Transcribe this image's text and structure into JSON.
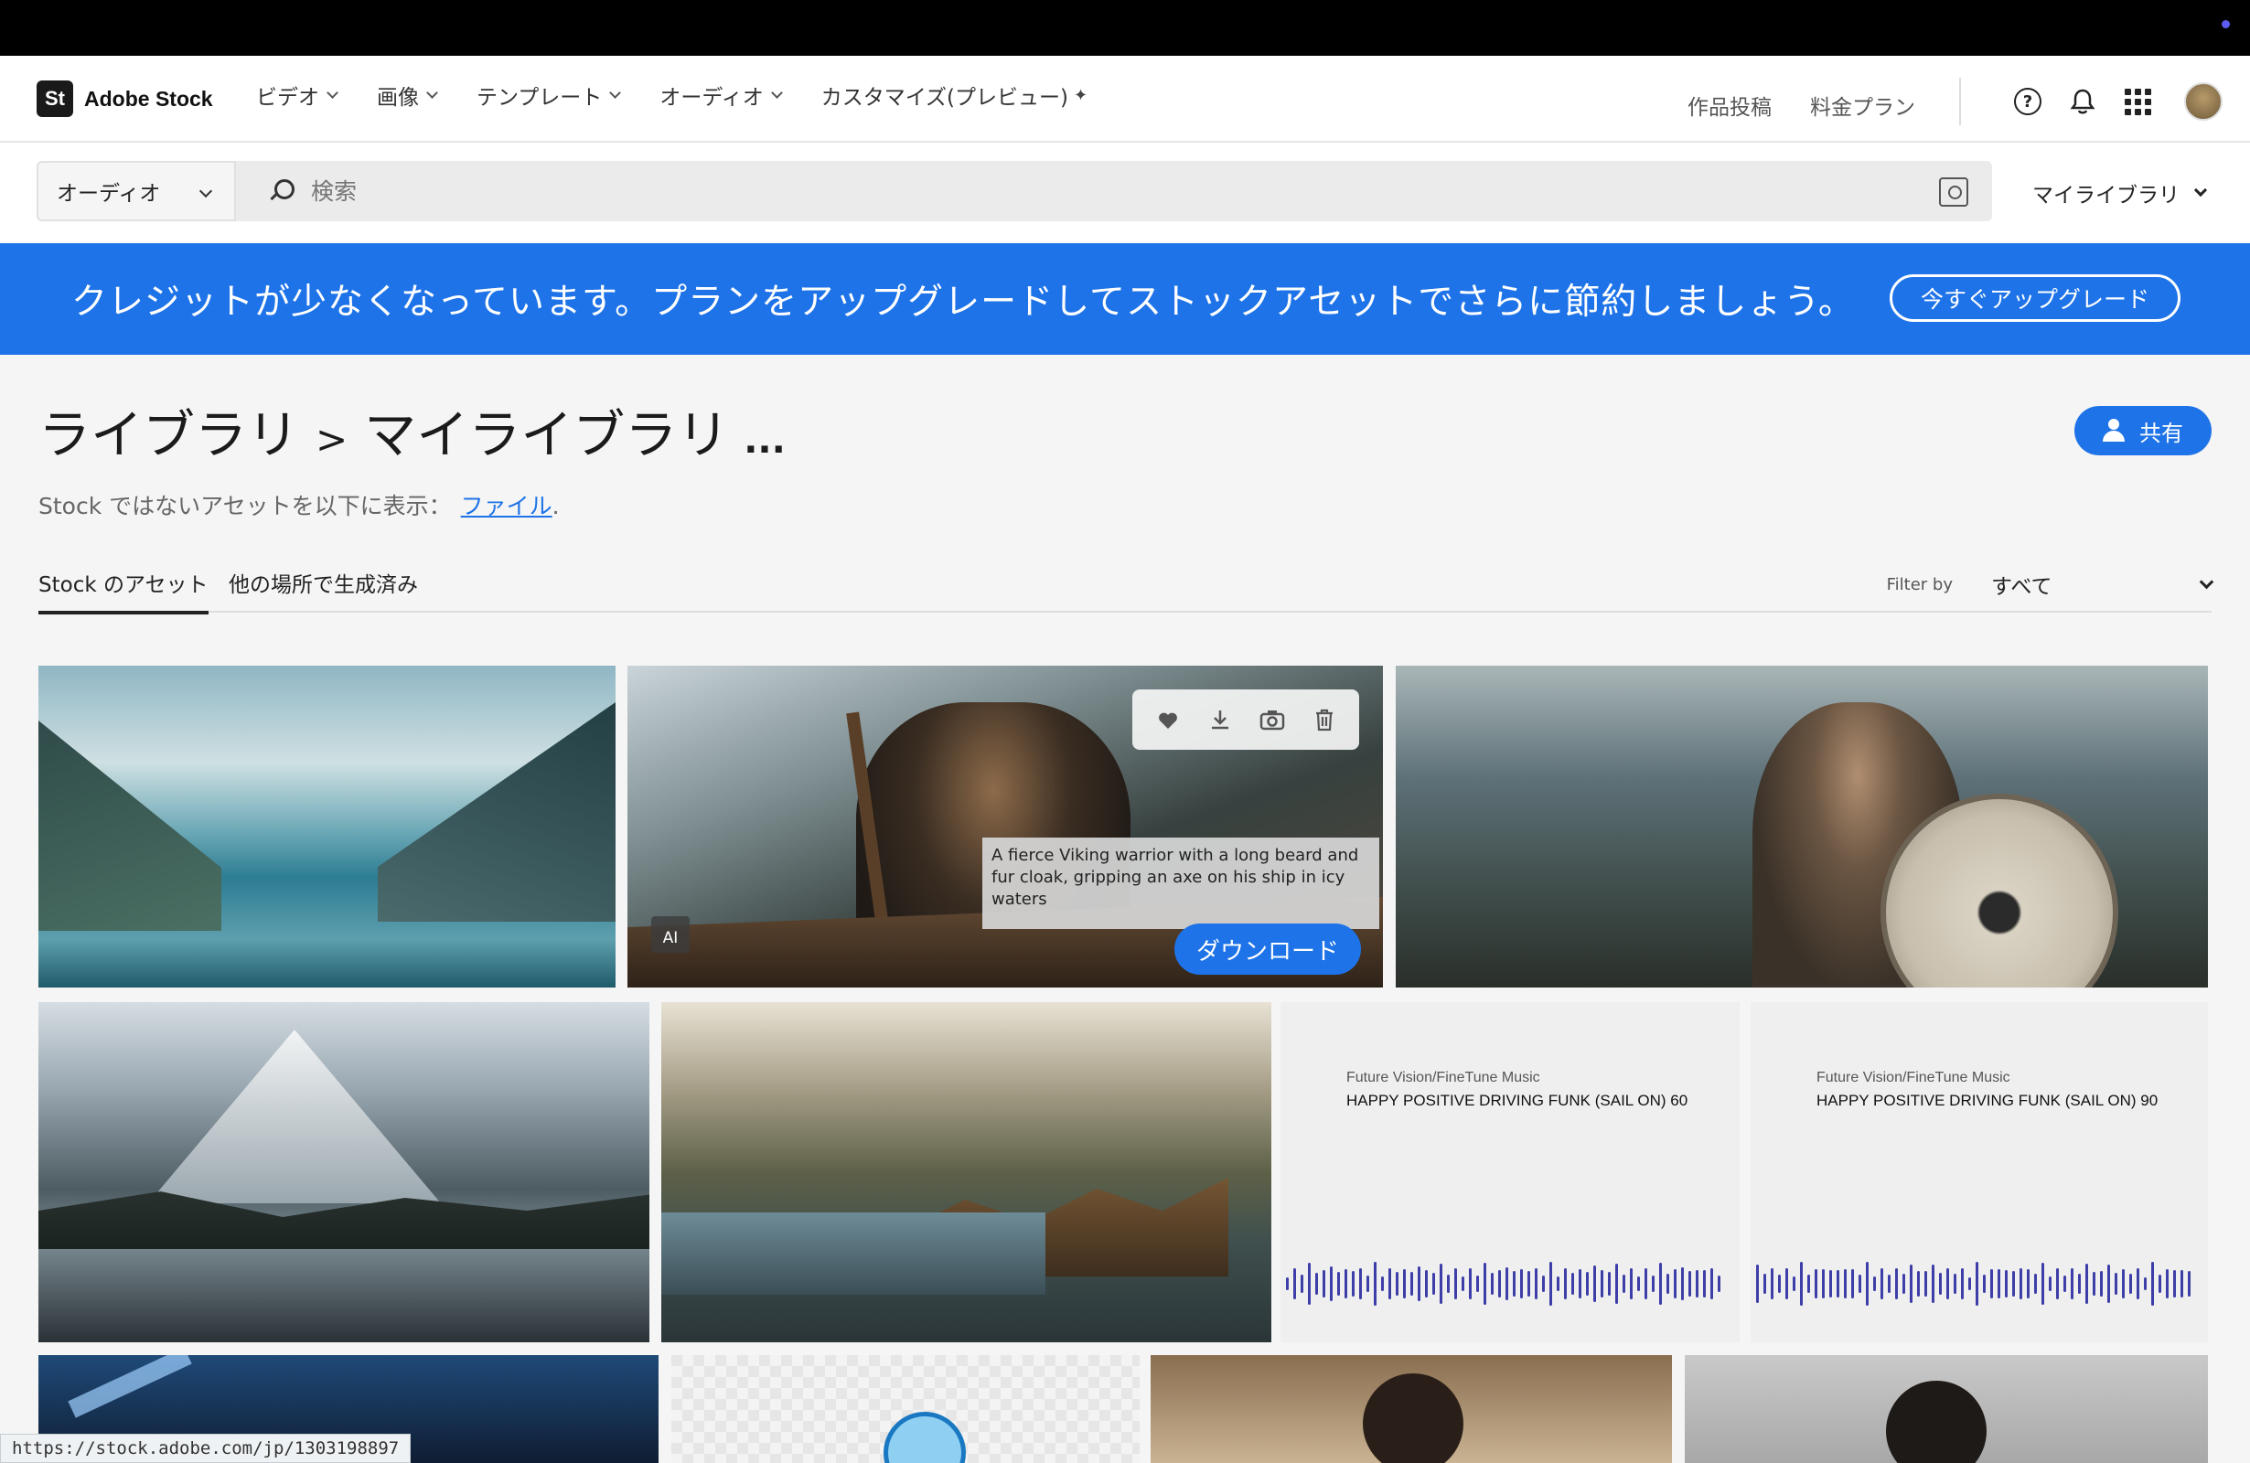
{
  "header": {
    "logo_mark": "St",
    "logo_text": "Adobe Stock",
    "nav": [
      "ビデオ",
      "画像",
      "テンプレート",
      "オーディオ",
      "カスタマイズ(プレビュー)"
    ],
    "right_links": [
      "作品投稿",
      "料金プラン"
    ],
    "help_glyph": "?"
  },
  "search": {
    "category": "オーディオ",
    "placeholder": "検索",
    "library_label": "マイライブラリ"
  },
  "banner": {
    "text": "クレジットが少なくなっています。プランをアップグレードしてストックアセットでさらに節約しましょう。",
    "button": "今すぐアップグレード"
  },
  "page": {
    "crumb_root": "ライブラリ",
    "crumb_sep": ">",
    "crumb_current": "マイライブラリ",
    "crumb_more": "...",
    "share_label": "共有",
    "subline_text": "Stock ではないアセットを以下に表示：",
    "subline_link": "ファイル",
    "subline_end": "."
  },
  "tabs": {
    "items": [
      "Stock のアセット",
      "他の場所で生成済み"
    ],
    "filter_label": "Filter by",
    "filter_value": "すべて"
  },
  "hover_tile": {
    "caption": "A fierce Viking warrior with a long beard and fur cloak, gripping an axe on his ship in icy waters",
    "ai_badge": "AI",
    "download": "ダウンロード"
  },
  "audio_tiles": [
    {
      "artist": "Future Vision/FineTune Music",
      "title": "HAPPY POSITIVE DRIVING FUNK (SAIL ON) 60"
    },
    {
      "artist": "Future Vision/FineTune Music",
      "title": "HAPPY POSITIVE DRIVING FUNK (SAIL ON) 90"
    }
  ],
  "status_url": "https://stock.adobe.com/jp/1303198897",
  "colors": {
    "accent": "#1e73e8",
    "waveform": "#3e3ea8"
  }
}
